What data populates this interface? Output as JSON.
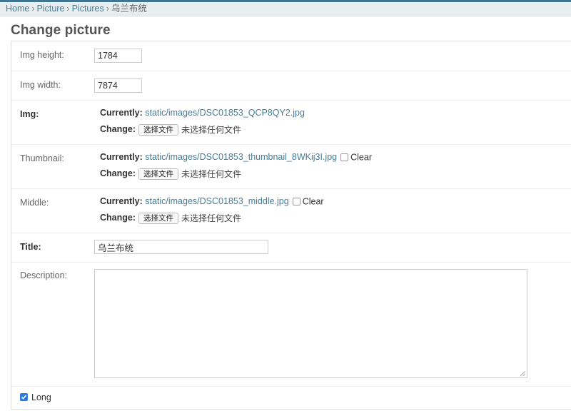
{
  "breadcrumbs": {
    "home": "Home",
    "app": "Picture",
    "model": "Pictures",
    "current": "乌兰布统",
    "separator": "›"
  },
  "page_title": "Change picture",
  "fields": {
    "img_height": {
      "label": "Img height:",
      "value": "1784"
    },
    "img_width": {
      "label": "Img width:",
      "value": "7874"
    },
    "img": {
      "label": "Img:",
      "currently_label": "Currently:",
      "current_file": "static/images/DSC01853_QCP8QY2.jpg",
      "change_label": "Change:",
      "button_label": "选择文件",
      "no_file_text": "未选择任何文件"
    },
    "thumbnail": {
      "label": "Thumbnail:",
      "currently_label": "Currently:",
      "current_file": "static/images/DSC01853_thumbnail_8WKij3I.jpg",
      "clear_label": "Clear",
      "clear_checked": false,
      "change_label": "Change:",
      "button_label": "选择文件",
      "no_file_text": "未选择任何文件"
    },
    "middle": {
      "label": "Middle:",
      "currently_label": "Currently:",
      "current_file": "static/images/DSC01853_middle.jpg",
      "clear_label": "Clear",
      "clear_checked": false,
      "change_label": "Change:",
      "button_label": "选择文件",
      "no_file_text": "未选择任何文件"
    },
    "title": {
      "label": "Title:",
      "value": "乌兰布统"
    },
    "description": {
      "label": "Description:",
      "value": ""
    },
    "long": {
      "label": "Long",
      "checked": true
    }
  },
  "colors": {
    "link": "#447e9b",
    "header_bar": "#417690",
    "breadcrumb_bg": "#e8eef0",
    "checkbox_checked": "#2a7ae2"
  }
}
